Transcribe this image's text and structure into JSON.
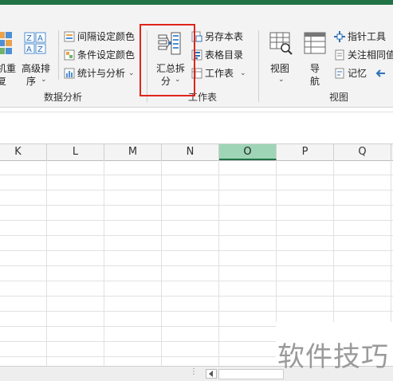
{
  "ribbon": {
    "groups": {
      "data_analysis": "数据分析",
      "worksheet": "工作表",
      "view": "视图"
    },
    "left_cut_button": {
      "line1": "机重",
      "line2": "复"
    },
    "sort_button": {
      "line1": "高级排",
      "line2": "序"
    },
    "data_small": [
      "间隔设定颜色",
      "条件设定颜色",
      "统计与分析"
    ],
    "merge_split_button": {
      "line1": "汇总拆",
      "line2": "分"
    },
    "worksheet_small": [
      "另存本表",
      "表格目录",
      "工作表"
    ],
    "view_button": {
      "line1": "视图"
    },
    "nav_button": {
      "line1": "导",
      "line2": "航"
    },
    "view_small": [
      "指针工具",
      "关注相同值",
      "记忆"
    ]
  },
  "columns": [
    "K",
    "L",
    "M",
    "N",
    "O",
    "P",
    "Q"
  ],
  "selected_column": "O",
  "watermark": "软件技巧",
  "colors": {
    "excel_green": "#217346",
    "highlight_red": "#e0241b",
    "selected_col_header": "#9fd5b7"
  }
}
